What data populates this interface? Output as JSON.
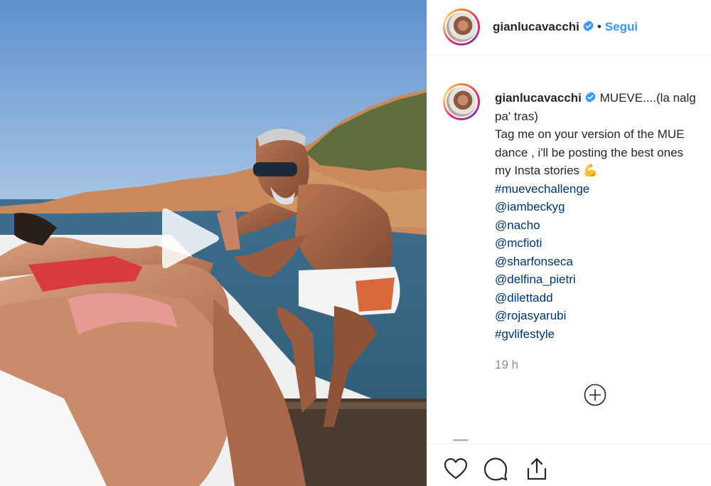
{
  "media": {
    "type": "video",
    "play_icon": "play-icon"
  },
  "header": {
    "username": "gianlucavacchi",
    "verified_icon": "verified-badge-icon",
    "separator": "•",
    "follow_label": "Segui"
  },
  "caption": {
    "username": "gianlucavacchi",
    "lines": [
      "MUEVE....(la nalg",
      "pa' tras)",
      "Tag me on your version of the MUE",
      "dance , i'll be posting the best ones",
      "my Insta stories 💪"
    ],
    "tags": [
      "#muevechallenge",
      "@iambeckyg",
      "@nacho",
      "@mcfioti",
      "@sharfonseca",
      "@delfina_pietri",
      "@dilettadd",
      "@rojasyarubi",
      "#gvlifestyle"
    ],
    "timestamp": "19 h"
  },
  "load_more_icon": "plus-circle-icon",
  "actions": {
    "like_icon": "heart-icon",
    "comment_icon": "comment-icon",
    "share_icon": "share-icon"
  },
  "colors": {
    "link": "#003569",
    "follow": "#3897f0",
    "muted": "#8e8e8e",
    "verified": "#3897f0"
  }
}
